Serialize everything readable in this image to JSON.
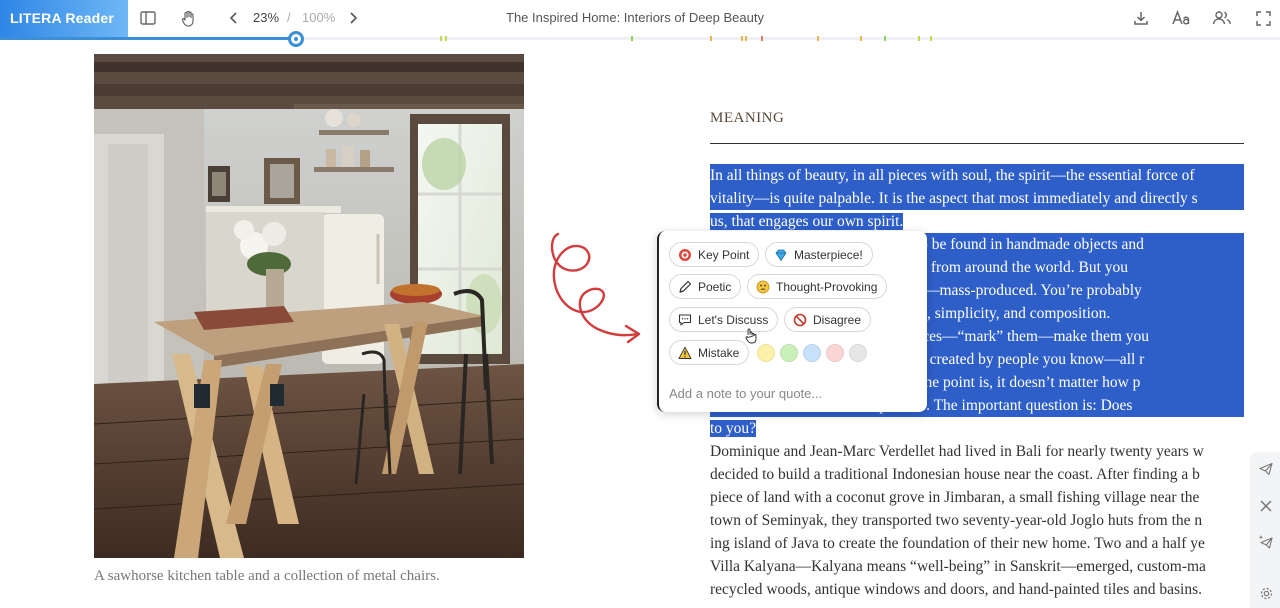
{
  "app": {
    "name": "LITERA Reader"
  },
  "toolbar": {
    "zoom_current": "23%",
    "zoom_separator": "/",
    "zoom_max": "100%",
    "document_title": "The Inspired Home: Interiors of Deep Beauty"
  },
  "reading_progress": {
    "fraction": 0.23
  },
  "page": {
    "figure_caption": "A sawhorse kitchen table and a collection of metal chairs.",
    "section_heading": "MEANING",
    "lines": [
      {
        "text": "In all things of beauty, in all pieces with soul, the spirit—the essential force of",
        "selected": true
      },
      {
        "text": "vitality—is quite palpable. It is the aspect that most immediately and directly s",
        "selected": true
      },
      {
        "text": "us, that engages our own spirit.",
        "selected": true
      },
      {
        "text": "                                   y more apt to be found in handmade objects and",
        "selected": true
      },
      {
        "text": "                                   rtisanal work from around the world. But you",
        "selected": true
      },
      {
        "text": "                                   been—gasp!—mass-produced. You’re probably",
        "selected": true
      },
      {
        "text": "                                   s proportions, simplicity, and composition.",
        "selected": true
      },
      {
        "text": "                                   ize these pieces—“mark” them—make them you",
        "selected": true
      },
      {
        "text": "                                   ooms, pieces created by people you know—all r",
        "selected": true
      },
      {
        "text": "                                   y may not. The point is, it doesn’t matter how p",
        "selected": true
      },
      {
        "text": "                                   ive a piece is. The important question is: Does",
        "selected": true
      },
      {
        "text": "to you?",
        "selected": true
      },
      {
        "text": "Dominique and Jean-Marc Verdellet had lived in Bali for nearly twenty years w",
        "selected": false
      },
      {
        "text": "decided to build a traditional Indonesian house near the coast. After finding a b",
        "selected": false
      },
      {
        "text": "piece of land with a coconut grove in Jimbaran, a small fishing village near the",
        "selected": false
      },
      {
        "text": "town of Seminyak, they transported two seventy-year-old Joglo huts from the n",
        "selected": false
      },
      {
        "text": "ing island of Java to create the foundation of their new home. Two and a half ye",
        "selected": false
      },
      {
        "text": "Villa Kalyana—Kalyana means “well-being” in Sanskrit—emerged, custom-ma",
        "selected": false
      },
      {
        "text": "recycled woods, antique windows and doors, and hand-painted tiles and basins.",
        "selected": false
      }
    ]
  },
  "quote_popover": {
    "tags": [
      {
        "label": "Key Point",
        "icon": "target-icon"
      },
      {
        "label": "Masterpiece!",
        "icon": "gem-icon"
      },
      {
        "label": "Poetic",
        "icon": "pen-icon"
      },
      {
        "label": "Thought-Provoking",
        "icon": "thinking-face-icon"
      },
      {
        "label": "Let's Discuss",
        "icon": "speech-bubble-icon"
      },
      {
        "label": "Disagree",
        "icon": "prohibited-icon"
      },
      {
        "label": "Mistake",
        "icon": "warning-icon"
      }
    ],
    "highlight_colors": [
      "#fdf0a8",
      "#c9f0b8",
      "#c7e1fb",
      "#fbd4d4",
      "#e6e6e6"
    ],
    "note_placeholder": "Add a note to your quote..."
  },
  "colors": {
    "accent": "#3a8fd6",
    "selection": "#2e5fc9",
    "annotation_ink": "#d33c3c"
  }
}
